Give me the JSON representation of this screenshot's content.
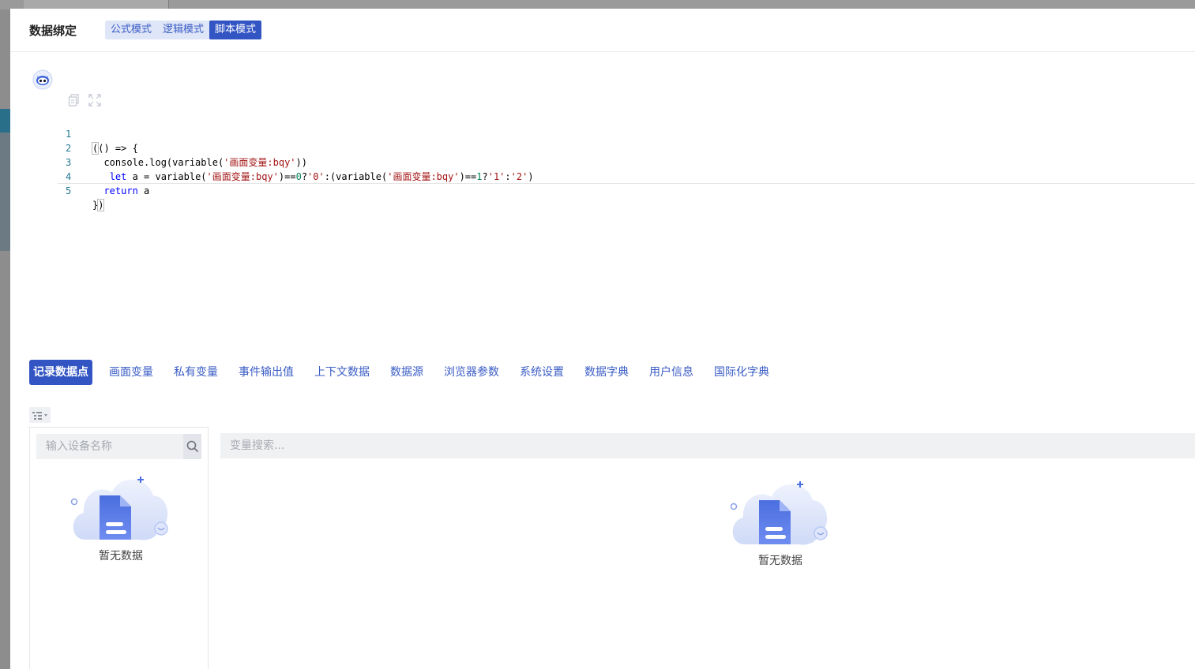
{
  "dialog": {
    "title": "数据绑定",
    "modes": [
      {
        "label": "公式模式",
        "active": false
      },
      {
        "label": "逻辑模式",
        "active": false
      },
      {
        "label": "脚本模式",
        "active": true
      }
    ]
  },
  "editor": {
    "line_numbers": [
      "1",
      "2",
      "3",
      "4",
      "5"
    ],
    "tools": [
      "copy-icon",
      "fullscreen-icon"
    ]
  },
  "tabs": [
    {
      "label": "记录数据点",
      "active": true
    },
    {
      "label": "画面变量",
      "active": false
    },
    {
      "label": "私有变量",
      "active": false
    },
    {
      "label": "事件输出值",
      "active": false
    },
    {
      "label": "上下文数据",
      "active": false
    },
    {
      "label": "数据源",
      "active": false
    },
    {
      "label": "浏览器参数",
      "active": false
    },
    {
      "label": "系统设置",
      "active": false
    },
    {
      "label": "数据字典",
      "active": false
    },
    {
      "label": "用户信息",
      "active": false
    },
    {
      "label": "国际化字典",
      "active": false
    }
  ],
  "device_search": {
    "placeholder": "输入设备名称",
    "value": ""
  },
  "variable_search": {
    "placeholder": "变量搜索...",
    "value": ""
  },
  "empty_state": {
    "text": "暂无数据"
  },
  "colors": {
    "accent": "#3355c4",
    "accent_light": "#dfe6f7"
  }
}
